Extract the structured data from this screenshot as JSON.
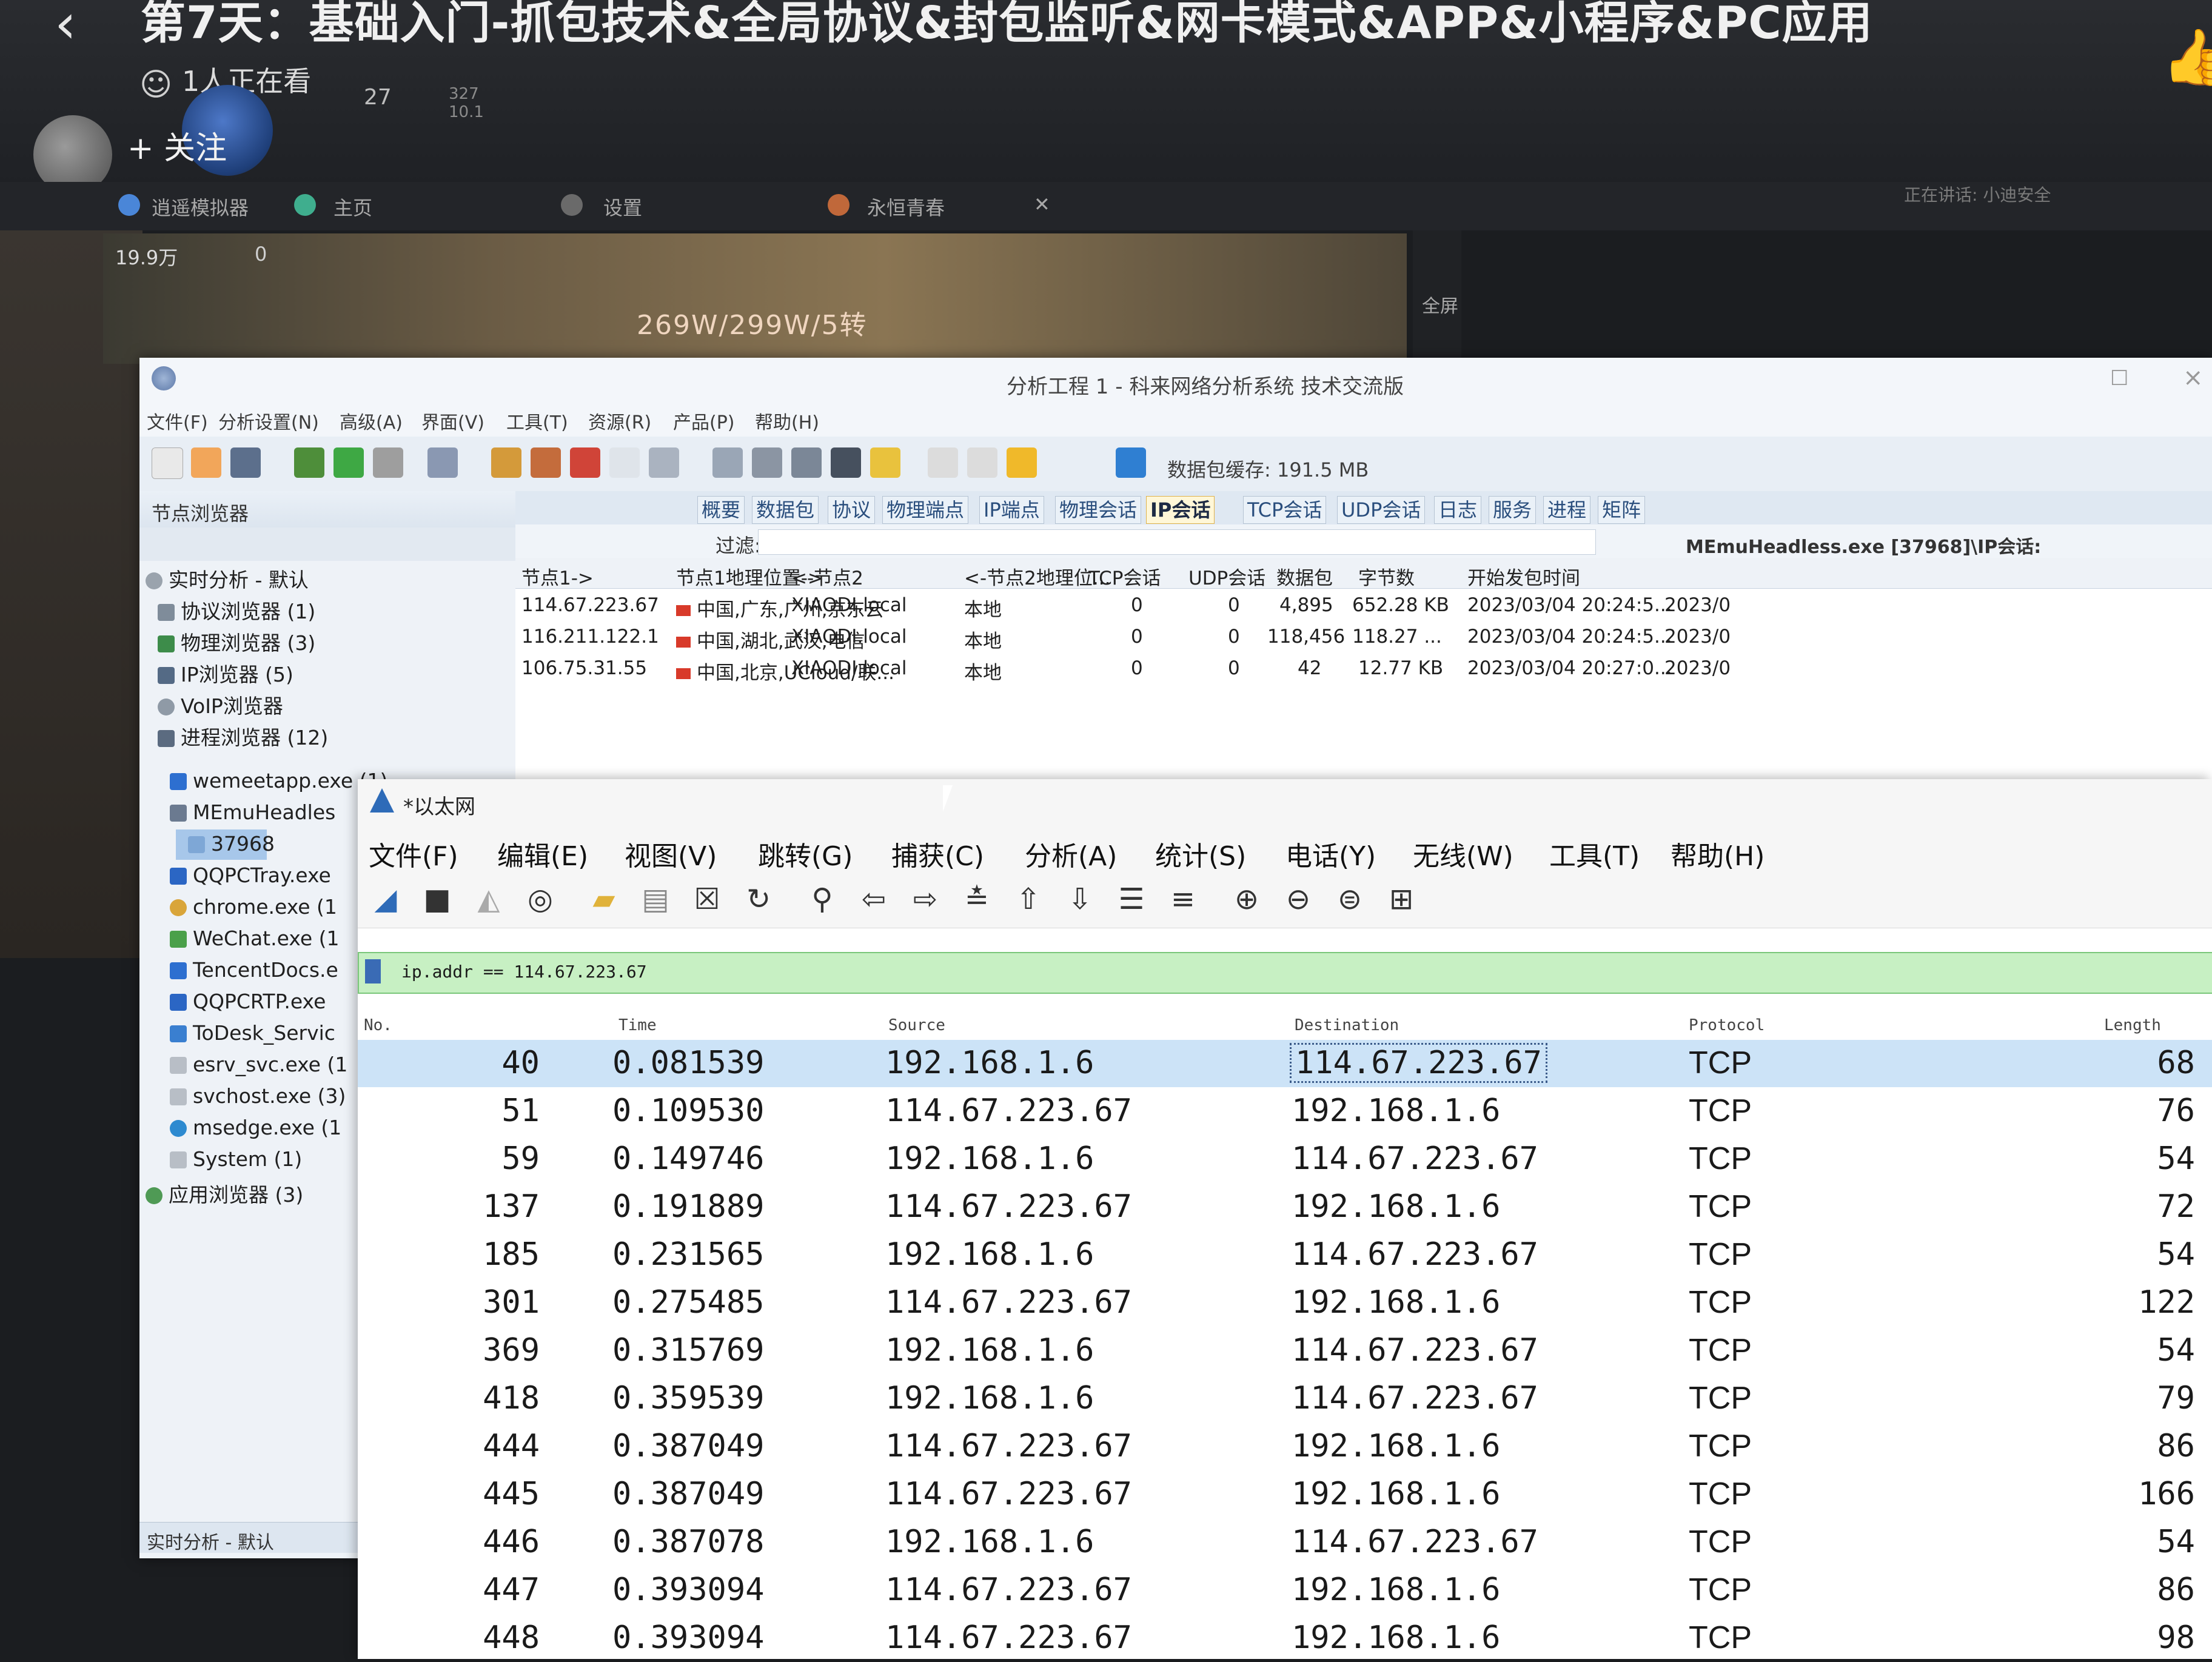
{
  "video": {
    "title": "第7天：基础入门-抓包技术&全局协议&封包监听&网卡模式&APP&小程序&PC应用",
    "viewers": "1人正在看",
    "follow": "+ 关注",
    "stat_main": "27",
    "stat_small1": "327",
    "stat_small2": "10.1"
  },
  "emulator_strip": {
    "items": [
      "逍遥模拟器",
      "主页",
      "设置",
      "永恒青春"
    ],
    "speaking": "正在讲话: 小迪安全"
  },
  "game": {
    "stat1": "19.9万",
    "stat2": "0",
    "damage": "269W/299W/5转",
    "fullscreen": "全屏"
  },
  "kelai": {
    "title": "分析工程 1 - 科来网络分析系统 技术交流版",
    "menu": [
      "文件(F)",
      "分析设置(N)",
      "高级(A)",
      "界面(V)",
      "工具(T)",
      "资源(R)",
      "产品(P)",
      "帮助(H)"
    ],
    "cache": "数据包缓存: 191.5 MB",
    "node_browser_title": "节点浏览器",
    "tree": [
      "实时分析 - 默认",
      "协议浏览器 (1)",
      "物理浏览器 (3)",
      "IP浏览器 (5)",
      "VoIP浏览器",
      "进程浏览器 (12)",
      "wemeetapp.exe (1)",
      "MEmuHeadles",
      "37968",
      "QQPCTray.exe",
      "chrome.exe (1",
      "WeChat.exe (1",
      "TencentDocs.e",
      "QQPCRTP.exe",
      "ToDesk_Servic",
      "esrv_svc.exe (1",
      "svchost.exe (3)",
      "msedge.exe (1",
      "System (1)",
      "应用浏览器 (3)"
    ],
    "status": "实时分析 - 默认",
    "tabs": [
      "概要",
      "数据包",
      "协议",
      "物理端点",
      "IP端点",
      "物理会话",
      "IP会话",
      "TCP会话",
      "UDP会话",
      "日志",
      "服务",
      "进程",
      "矩阵"
    ],
    "active_tab": "IP会话",
    "filter_label": "过滤:",
    "context": "MEmuHeadless.exe [37968]\\IP会话:",
    "columns": [
      "节点1->",
      "节点1地理位置->",
      "<-节点2",
      "<-节点2地理位...",
      "TCP会话",
      "UDP会话",
      "数据包",
      "字节数",
      "开始发包时间"
    ],
    "rows": [
      {
        "n1": "114.67.223.67",
        "geo1": "中国,广东,广州,京东云",
        "n2": "XIAODI.local",
        "geo2": "本地",
        "tcp": "0",
        "udp": "0",
        "pkts": "4,895",
        "bytes": "652.28 KB",
        "start": "2023/03/04 20:24:5...",
        "end": "2023/0"
      },
      {
        "n1": "116.211.122.1",
        "geo1": "中国,湖北,武汉,电信",
        "n2": "XIAODI.local",
        "geo2": "本地",
        "tcp": "0",
        "udp": "0",
        "pkts": "118,456",
        "bytes": "118.27 ...",
        "start": "2023/03/04 20:24:5...",
        "end": "2023/0"
      },
      {
        "n1": "106.75.31.55",
        "geo1": "中国,北京,UCloud/联...",
        "n2": "XIAODI.local",
        "geo2": "本地",
        "tcp": "0",
        "udp": "0",
        "pkts": "42",
        "bytes": "12.77 KB",
        "start": "2023/03/04 20:27:0...",
        "end": "2023/0"
      }
    ]
  },
  "wireshark": {
    "title": "*以太网",
    "menu": [
      "文件(F)",
      "编辑(E)",
      "视图(V)",
      "跳转(G)",
      "捕获(C)",
      "分析(A)",
      "统计(S)",
      "电话(Y)",
      "无线(W)",
      "工具(T)",
      "帮助(H)"
    ],
    "filter": "ip.addr == 114.67.223.67",
    "columns": {
      "no": "No.",
      "time": "Time",
      "source": "Source",
      "destination": "Destination",
      "protocol": "Protocol",
      "length": "Length"
    },
    "packets": [
      {
        "no": "40",
        "time": "0.081539",
        "src": "192.168.1.6",
        "dst": "114.67.223.67",
        "proto": "TCP",
        "len": "68"
      },
      {
        "no": "51",
        "time": "0.109530",
        "src": "114.67.223.67",
        "dst": "192.168.1.6",
        "proto": "TCP",
        "len": "76"
      },
      {
        "no": "59",
        "time": "0.149746",
        "src": "192.168.1.6",
        "dst": "114.67.223.67",
        "proto": "TCP",
        "len": "54"
      },
      {
        "no": "137",
        "time": "0.191889",
        "src": "114.67.223.67",
        "dst": "192.168.1.6",
        "proto": "TCP",
        "len": "72"
      },
      {
        "no": "185",
        "time": "0.231565",
        "src": "192.168.1.6",
        "dst": "114.67.223.67",
        "proto": "TCP",
        "len": "54"
      },
      {
        "no": "301",
        "time": "0.275485",
        "src": "114.67.223.67",
        "dst": "192.168.1.6",
        "proto": "TCP",
        "len": "122"
      },
      {
        "no": "369",
        "time": "0.315769",
        "src": "192.168.1.6",
        "dst": "114.67.223.67",
        "proto": "TCP",
        "len": "54"
      },
      {
        "no": "418",
        "time": "0.359539",
        "src": "192.168.1.6",
        "dst": "114.67.223.67",
        "proto": "TCP",
        "len": "79"
      },
      {
        "no": "444",
        "time": "0.387049",
        "src": "114.67.223.67",
        "dst": "192.168.1.6",
        "proto": "TCP",
        "len": "86"
      },
      {
        "no": "445",
        "time": "0.387049",
        "src": "114.67.223.67",
        "dst": "192.168.1.6",
        "proto": "TCP",
        "len": "166"
      },
      {
        "no": "446",
        "time": "0.387078",
        "src": "192.168.1.6",
        "dst": "114.67.223.67",
        "proto": "TCP",
        "len": "54"
      },
      {
        "no": "447",
        "time": "0.393094",
        "src": "114.67.223.67",
        "dst": "192.168.1.6",
        "proto": "TCP",
        "len": "86"
      },
      {
        "no": "448",
        "time": "0.393094",
        "src": "114.67.223.67",
        "dst": "192.168.1.6",
        "proto": "TCP",
        "len": "98"
      }
    ]
  }
}
